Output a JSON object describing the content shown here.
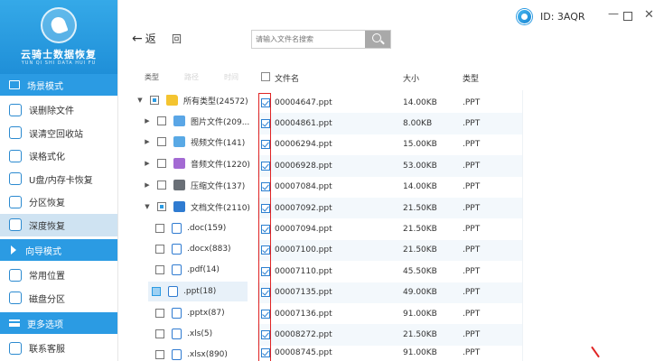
{
  "app": {
    "title": "云骑士数据恢复",
    "subtitle": "YUN QI SHI DATA HUI FU",
    "id_label": "ID: 3AQR"
  },
  "colors": {
    "accent": "#2b9be3",
    "active_bg": "#cfe3f2",
    "highlight": "#e02424"
  },
  "sidebar": {
    "sections": [
      {
        "label": "场景模式",
        "icon": "monitor-icon",
        "items": [
          {
            "label": "误删除文件",
            "icon": "delete-file-icon"
          },
          {
            "label": "误清空回收站",
            "icon": "recycle-bin-icon"
          },
          {
            "label": "误格式化",
            "icon": "format-icon"
          },
          {
            "label": "U盘/内存卡恢复",
            "icon": "usb-icon"
          },
          {
            "label": "分区恢复",
            "icon": "partition-icon"
          },
          {
            "label": "深度恢复",
            "icon": "deep-scan-icon",
            "active": true
          }
        ]
      },
      {
        "label": "向导模式",
        "icon": "wizard-icon",
        "items": [
          {
            "label": "常用位置",
            "icon": "location-icon"
          },
          {
            "label": "磁盘分区",
            "icon": "disk-icon"
          }
        ]
      },
      {
        "label": "更多选项",
        "icon": "menu-icon",
        "items": [
          {
            "label": "联系客服",
            "icon": "support-icon"
          }
        ]
      }
    ]
  },
  "toolbar": {
    "back_label": "返",
    "home_label": "回",
    "search_placeholder": "请输入文件名搜索"
  },
  "tree": {
    "tabs": [
      "类型",
      "路径",
      "时间"
    ],
    "nodes": [
      {
        "label": "所有类型(24572)",
        "icon": "folder-icon",
        "expanded": true,
        "check": "partial",
        "level": 0
      },
      {
        "label": "图片文件(209...",
        "icon": "image-file-icon",
        "expanded": false,
        "check": "none",
        "level": 1
      },
      {
        "label": "视频文件(141)",
        "icon": "video-file-icon",
        "expanded": false,
        "check": "none",
        "level": 1
      },
      {
        "label": "音频文件(1220)",
        "icon": "audio-file-icon",
        "expanded": false,
        "check": "none",
        "level": 1
      },
      {
        "label": "压缩文件(137)",
        "icon": "archive-file-icon",
        "expanded": false,
        "check": "none",
        "level": 1
      },
      {
        "label": "文档文件(2110)",
        "icon": "document-file-icon",
        "expanded": true,
        "check": "partial",
        "level": 1
      },
      {
        "label": ".doc(159)",
        "icon": "doc-icon",
        "check": "none",
        "level": 2
      },
      {
        "label": ".docx(883)",
        "icon": "doc-icon",
        "check": "none",
        "level": 2
      },
      {
        "label": ".pdf(14)",
        "icon": "doc-icon",
        "check": "none",
        "level": 2
      },
      {
        "label": ".ppt(18)",
        "icon": "doc-icon",
        "check": "partial",
        "level": 2,
        "selected": true
      },
      {
        "label": ".pptx(87)",
        "icon": "doc-icon",
        "check": "none",
        "level": 2
      },
      {
        "label": ".xls(5)",
        "icon": "doc-icon",
        "check": "none",
        "level": 2
      },
      {
        "label": ".xlsx(890)",
        "icon": "doc-icon",
        "check": "none",
        "level": 2
      }
    ]
  },
  "table": {
    "headers": {
      "name": "文件名",
      "size": "大小",
      "type": "类型"
    },
    "rows": [
      {
        "name": "00004647.ppt",
        "size": "14.00KB",
        "type": ".PPT",
        "checked": true
      },
      {
        "name": "00004861.ppt",
        "size": "8.00KB",
        "type": ".PPT",
        "checked": true
      },
      {
        "name": "00006294.ppt",
        "size": "15.00KB",
        "type": ".PPT",
        "checked": true
      },
      {
        "name": "00006928.ppt",
        "size": "53.00KB",
        "type": ".PPT",
        "checked": true
      },
      {
        "name": "00007084.ppt",
        "size": "14.00KB",
        "type": ".PPT",
        "checked": true
      },
      {
        "name": "00007092.ppt",
        "size": "21.50KB",
        "type": ".PPT",
        "checked": true
      },
      {
        "name": "00007094.ppt",
        "size": "21.50KB",
        "type": ".PPT",
        "checked": true
      },
      {
        "name": "00007100.ppt",
        "size": "21.50KB",
        "type": ".PPT",
        "checked": true
      },
      {
        "name": "00007110.ppt",
        "size": "45.50KB",
        "type": ".PPT",
        "checked": true
      },
      {
        "name": "00007135.ppt",
        "size": "49.00KB",
        "type": ".PPT",
        "checked": true
      },
      {
        "name": "00007136.ppt",
        "size": "91.00KB",
        "type": ".PPT",
        "checked": true
      },
      {
        "name": "00008272.ppt",
        "size": "21.50KB",
        "type": ".PPT",
        "checked": true
      },
      {
        "name": "00008745.ppt",
        "size": "91.00KB",
        "type": ".PPT",
        "checked": true
      }
    ]
  }
}
